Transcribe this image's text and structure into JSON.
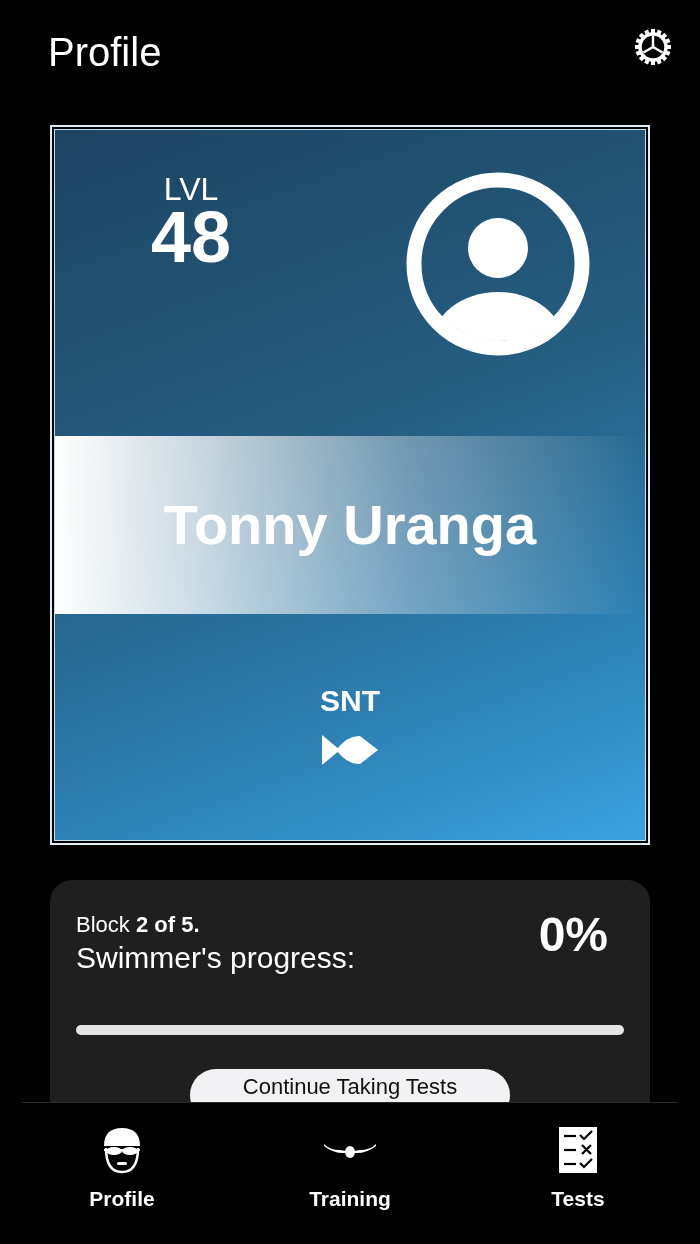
{
  "header": {
    "title": "Profile"
  },
  "profile_card": {
    "level_label": "LVL",
    "level": "48",
    "name": "Tonny Uranga",
    "group": "SNT"
  },
  "progress_card": {
    "block_text": "Block **2 of 5.**",
    "caption": "Swimmer's progress:",
    "percent": "0%",
    "level": 0,
    "button": "Continue Taking Tests"
  },
  "tab_bar": [
    {
      "label": "Profile",
      "kind": "swimmer"
    },
    {
      "label": "Training",
      "kind": "stroke"
    },
    {
      "label": "Tests",
      "kind": "checklist"
    }
  ]
}
